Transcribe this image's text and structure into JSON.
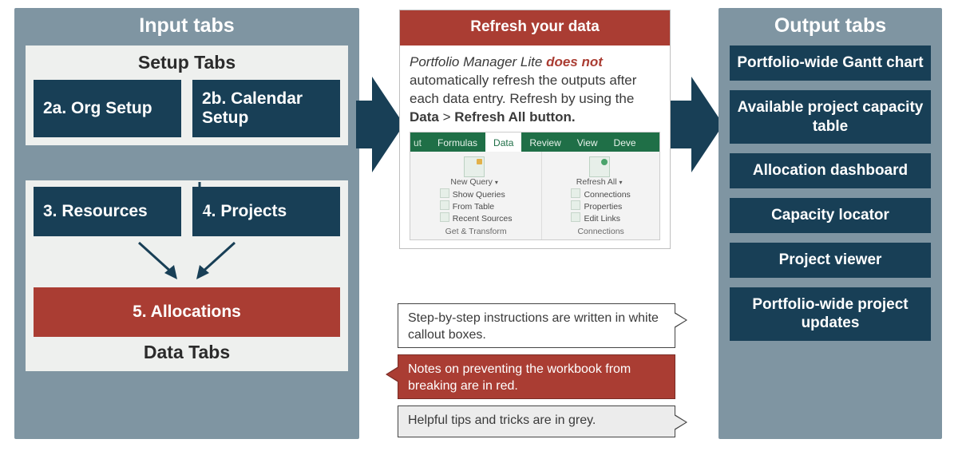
{
  "input_panel": {
    "title": "Input tabs",
    "setup": {
      "title": "Setup Tabs",
      "org": "2a. Org Setup",
      "calendar": "2b. Calendar Setup"
    },
    "data": {
      "title": "Data Tabs",
      "resources": "3. Resources",
      "projects": "4. Projects",
      "allocations": "5. Allocations"
    }
  },
  "refresh_card": {
    "header": "Refresh your data",
    "product_name": "Portfolio Manager Lite",
    "does_not": "does not",
    "body_rest": " automatically refresh the outputs after each data entry. Refresh by using the ",
    "bold_data": "Data",
    "sep": " > ",
    "bold_refresh": "Refresh All button."
  },
  "ribbon": {
    "tabs": {
      "cut": "ut",
      "formulas": "Formulas",
      "data": "Data",
      "review": "Review",
      "view": "View",
      "developer": "Deve"
    },
    "get_transform": {
      "new_query": "New Query",
      "show_queries": "Show Queries",
      "from_table": "From Table",
      "recent_sources": "Recent Sources",
      "group_label": "Get & Transform"
    },
    "connections": {
      "refresh_all": "Refresh All",
      "connections": "Connections",
      "properties": "Properties",
      "edit_links": "Edit Links",
      "group_label": "Connections"
    }
  },
  "callouts": {
    "white": "Step-by-step instructions are written in white callout boxes.",
    "red": "Notes on preventing the workbook from breaking are in red.",
    "grey": "Helpful tips and tricks are in grey."
  },
  "output_panel": {
    "title": "Output tabs",
    "items": [
      "Portfolio-wide Gantt chart",
      "Available project capacity table",
      "Allocation dashboard",
      "Capacity locator",
      "Project viewer",
      "Portfolio-wide project updates"
    ]
  }
}
